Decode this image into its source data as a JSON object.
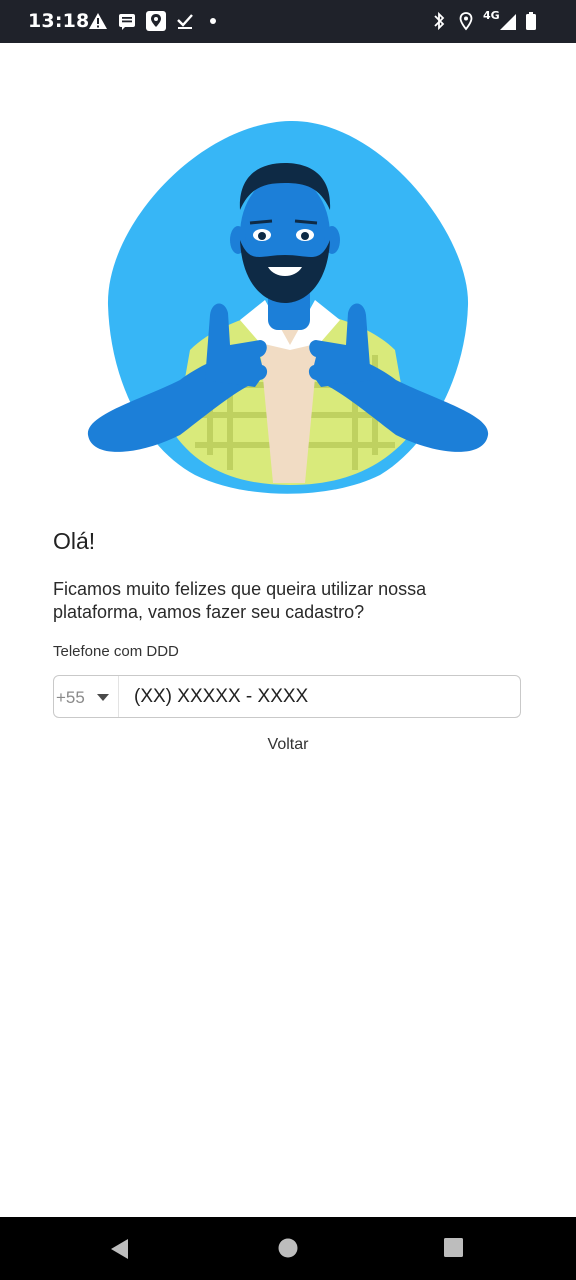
{
  "status_bar": {
    "time": "13:18",
    "network": "4G",
    "icons": [
      "alert-icon",
      "message-icon",
      "location-app-icon",
      "check-icon",
      "dot-icon",
      "bluetooth-icon",
      "location-icon",
      "signal-icon",
      "battery-icon"
    ]
  },
  "content": {
    "greeting": "Olá!",
    "intro": "Ficamos muito felizes que queira utilizar nossa plataforma, vamos fazer seu cadastro?",
    "phone_label": "Telefone com DDD",
    "country_code": "+55",
    "phone_placeholder": "(XX) XXXXX - XXXX",
    "back_link": "Voltar"
  },
  "navigation": {
    "buttons": [
      "back-icon",
      "home-icon",
      "recents-icon"
    ]
  },
  "colors": {
    "status_bar_bg": "#1f222a",
    "blob_blue": "#37b6f6",
    "character_blue": "#1c7fd8",
    "shirt_yellow": "#d9ea7b",
    "nav_bar_bg": "#000000"
  }
}
